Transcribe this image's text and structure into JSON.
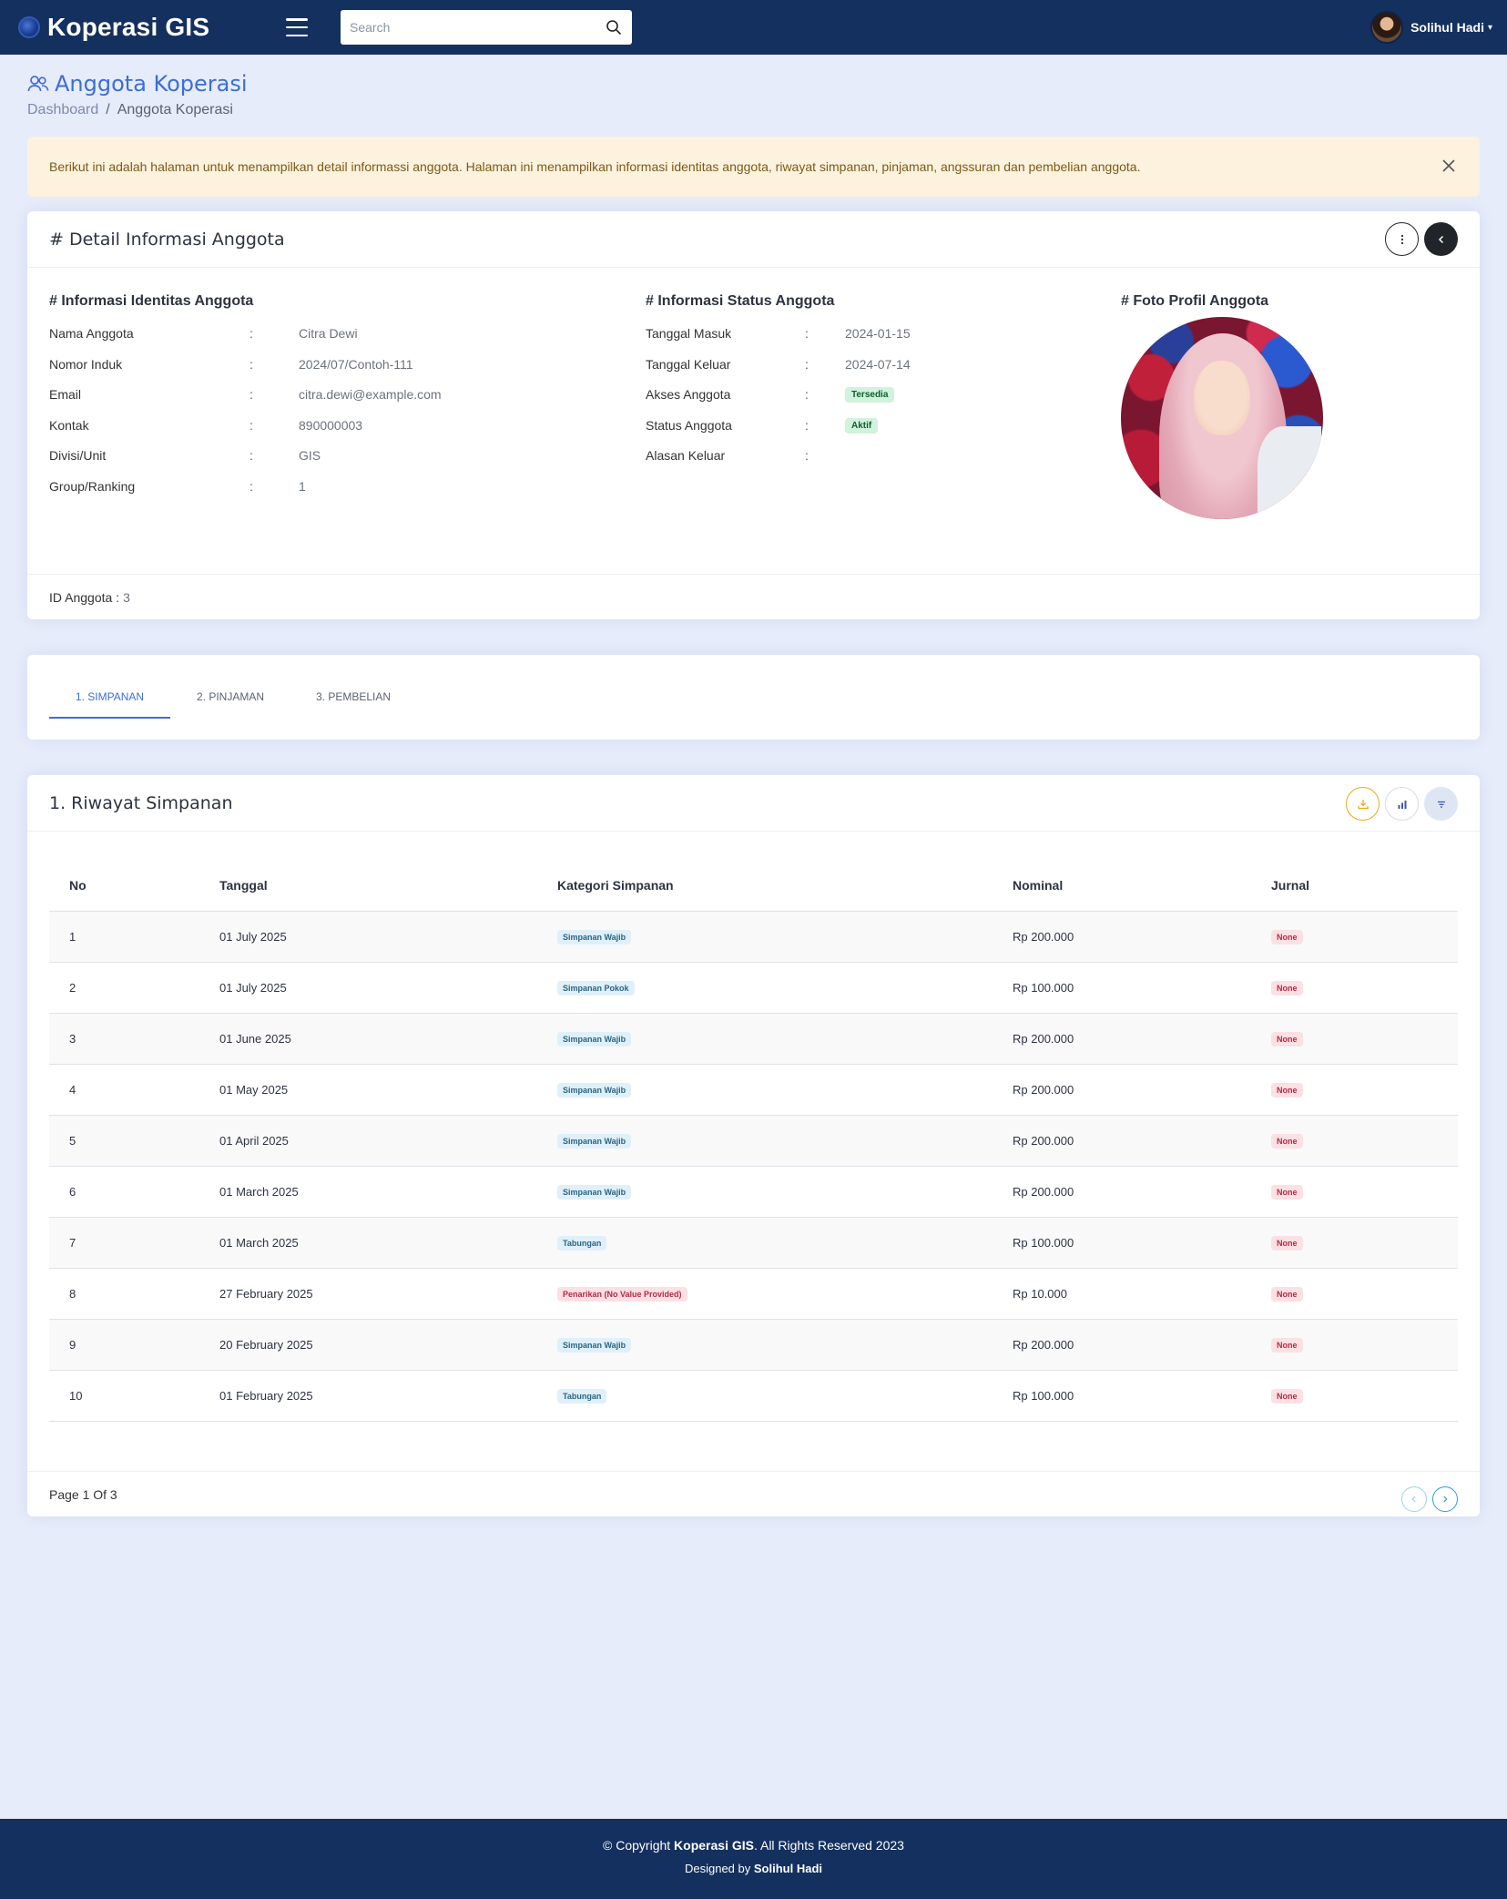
{
  "header": {
    "brand": "Koperasi GIS",
    "search_placeholder": "Search",
    "user_name": "Solihul Hadi"
  },
  "page": {
    "title": "Anggota Koperasi",
    "breadcrumb": [
      "Dashboard",
      "Anggota Koperasi"
    ]
  },
  "alert": {
    "text": "Berikut ini adalah halaman untuk menampilkan detail informassi anggota. Halaman ini menampilkan informasi identitas anggota, riwayat simpanan, pinjaman, angssuran dan pembelian anggota."
  },
  "detail": {
    "title": "# Detail Informasi Anggota",
    "identity": {
      "heading": "# Informasi Identitas Anggota",
      "rows": [
        {
          "label": "Nama Anggota",
          "value": "Citra Dewi"
        },
        {
          "label": "Nomor Induk",
          "value": "2024/07/Contoh-111"
        },
        {
          "label": "Email",
          "value": "citra.dewi@example.com"
        },
        {
          "label": "Kontak",
          "value": "890000003"
        },
        {
          "label": "Divisi/Unit",
          "value": "GIS"
        },
        {
          "label": "Group/Ranking",
          "value": "1"
        }
      ]
    },
    "status": {
      "heading": "# Informasi Status Anggota",
      "rows": [
        {
          "label": "Tanggal Masuk",
          "value": "2024-01-15"
        },
        {
          "label": "Tanggal Keluar",
          "value": "2024-07-14"
        },
        {
          "label": "Akses Anggota",
          "value": "Tersedia"
        },
        {
          "label": "Status Anggota",
          "value": "Aktif"
        },
        {
          "label": "Alasan Keluar",
          "value": ""
        }
      ]
    },
    "photo_heading": "# Foto Profil Anggota",
    "colon": ":",
    "footer_label": "ID Anggota :",
    "footer_value": "3"
  },
  "tabs": [
    "1. SIMPANAN",
    "2. PINJAMAN",
    "3. PEMBELIAN"
  ],
  "savings": {
    "title": "1. Riwayat Simpanan",
    "columns": [
      "No",
      "Tanggal",
      "Kategori Simpanan",
      "Nominal",
      "Jurnal"
    ],
    "rows": [
      {
        "no": "1",
        "date": "01 July 2025",
        "category": "Simpanan Wajib",
        "nominal": "Rp 200.000",
        "journal": "None"
      },
      {
        "no": "2",
        "date": "01 July 2025",
        "category": "Simpanan Pokok",
        "nominal": "Rp 100.000",
        "journal": "None"
      },
      {
        "no": "3",
        "date": "01 June 2025",
        "category": "Simpanan Wajib",
        "nominal": "Rp 200.000",
        "journal": "None"
      },
      {
        "no": "4",
        "date": "01 May 2025",
        "category": "Simpanan Wajib",
        "nominal": "Rp 200.000",
        "journal": "None"
      },
      {
        "no": "5",
        "date": "01 April 2025",
        "category": "Simpanan Wajib",
        "nominal": "Rp 200.000",
        "journal": "None"
      },
      {
        "no": "6",
        "date": "01 March 2025",
        "category": "Simpanan Wajib",
        "nominal": "Rp 200.000",
        "journal": "None"
      },
      {
        "no": "7",
        "date": "01 March 2025",
        "category": "Tabungan",
        "nominal": "Rp 100.000",
        "journal": "None"
      },
      {
        "no": "8",
        "date": "27 February 2025",
        "category": "Penarikan (No Value Provided)",
        "nominal": "Rp 10.000",
        "journal": "None"
      },
      {
        "no": "9",
        "date": "20 February 2025",
        "category": "Simpanan Wajib",
        "nominal": "Rp 200.000",
        "journal": "None"
      },
      {
        "no": "10",
        "date": "01 February 2025",
        "category": "Tabungan",
        "nominal": "Rp 100.000",
        "journal": "None"
      }
    ],
    "page_info": "Page 1 Of 3"
  },
  "footer": {
    "copyright_prefix": "© Copyright",
    "brand": "Koperasi GIS",
    "copyright_suffix": ". All Rights Reserved 2023",
    "designed_prefix": "Designed by",
    "designer": "Solihul Hadi"
  },
  "colors": {
    "navy": "#14305e",
    "accent": "#3d6dd6",
    "background": "#e6ecfa",
    "warning": "#f0a71b"
  },
  "icons": {
    "brand": "globe-logo-icon",
    "menu": "hamburger-icon",
    "search": "search-icon",
    "title": "people-icon",
    "close": "close-icon",
    "more": "more-vertical-icon",
    "back": "chevron-left-icon",
    "download": "download-icon",
    "chart": "bar-chart-icon",
    "filter": "filter-icon",
    "prev": "chevron-left-icon",
    "next": "chevron-right-icon"
  }
}
